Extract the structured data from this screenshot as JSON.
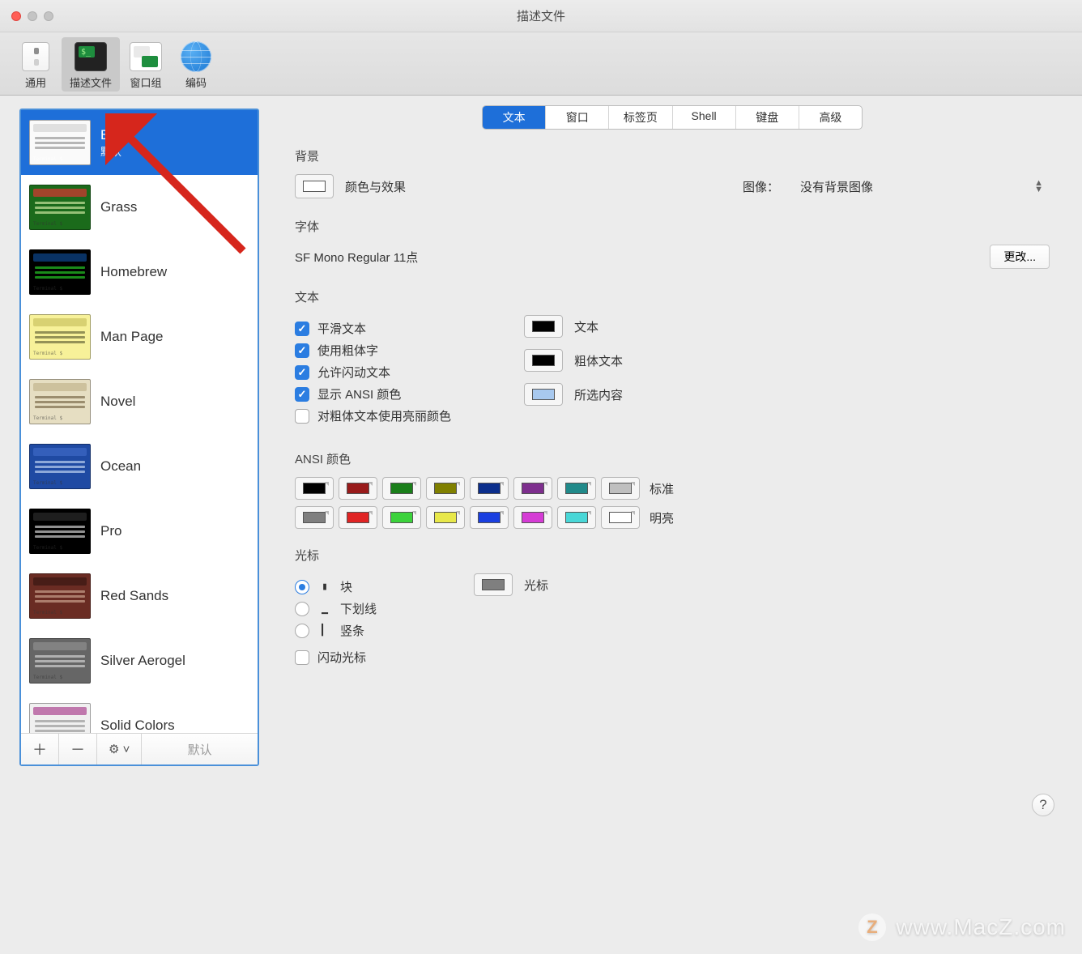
{
  "window": {
    "title": "描述文件"
  },
  "toolbar": {
    "items": [
      {
        "id": "general",
        "label": "通用"
      },
      {
        "id": "profiles",
        "label": "描述文件"
      },
      {
        "id": "wgroups",
        "label": "窗口组"
      },
      {
        "id": "encoding",
        "label": "编码"
      }
    ]
  },
  "sidebar": {
    "profiles": [
      {
        "name": "Basic",
        "subtitle": "默认",
        "theme": "basic",
        "selected": true
      },
      {
        "name": "Grass",
        "theme": "grass"
      },
      {
        "name": "Homebrew",
        "theme": "homebrew"
      },
      {
        "name": "Man Page",
        "theme": "manpage"
      },
      {
        "name": "Novel",
        "theme": "novel"
      },
      {
        "name": "Ocean",
        "theme": "ocean"
      },
      {
        "name": "Pro",
        "theme": "pro"
      },
      {
        "name": "Red Sands",
        "theme": "redsands"
      },
      {
        "name": "Silver Aerogel",
        "theme": "silver"
      },
      {
        "name": "Solid Colors",
        "theme": "solid"
      }
    ],
    "footer_default": "默认"
  },
  "tabs": [
    "文本",
    "窗口",
    "标签页",
    "Shell",
    "键盘",
    "高级"
  ],
  "active_tab": "文本",
  "background": {
    "section": "背景",
    "color_effects": "颜色与效果",
    "image_label": "图像：",
    "image_value": "没有背景图像"
  },
  "font": {
    "section": "字体",
    "current": "SF Mono Regular 11点",
    "change": "更改..."
  },
  "text": {
    "section": "文本",
    "checks": [
      {
        "label": "平滑文本",
        "checked": true
      },
      {
        "label": "使用粗体字",
        "checked": true
      },
      {
        "label": "允许闪动文本",
        "checked": true
      },
      {
        "label": "显示 ANSI 颜色",
        "checked": true
      },
      {
        "label": "对粗体文本使用亮丽颜色",
        "checked": false
      }
    ],
    "wells": [
      {
        "label": "文本",
        "color": "#000000"
      },
      {
        "label": "粗体文本",
        "color": "#000000"
      },
      {
        "label": "所选内容",
        "color": "#a8c9ef"
      }
    ]
  },
  "ansi": {
    "section": "ANSI 颜色",
    "rows": [
      {
        "label": "标准",
        "colors": [
          "#000000",
          "#991b1b",
          "#1a7f1a",
          "#808000",
          "#0b2e8c",
          "#7e2f8e",
          "#218a8a",
          "#bfbfbf"
        ]
      },
      {
        "label": "明亮",
        "colors": [
          "#7f7f7f",
          "#e02424",
          "#3bd23b",
          "#e8e84a",
          "#1a3fe0",
          "#d53cd5",
          "#49d7d7",
          "#ffffff"
        ]
      }
    ]
  },
  "cursor": {
    "section": "光标",
    "options": [
      {
        "sample": "▮",
        "label": "块",
        "checked": true
      },
      {
        "sample": "▁",
        "label": "下划线",
        "checked": false
      },
      {
        "sample": "▎",
        "label": "竖条",
        "checked": false
      }
    ],
    "well_label": "光标",
    "well_color": "#7f7f7f",
    "blink_label": "闪动光标",
    "blink_checked": false
  },
  "watermark": {
    "badge": "Z",
    "text": "www.MacZ.com"
  }
}
